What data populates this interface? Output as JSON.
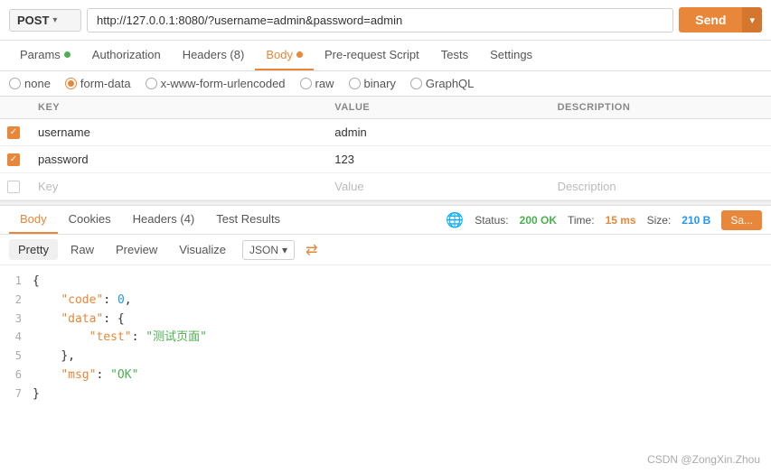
{
  "method": {
    "label": "POST",
    "chevron": "▾"
  },
  "url": {
    "value": "http://127.0.0.1:8080/?username=admin&password=admin"
  },
  "toolbar": {
    "send_label": "Send",
    "arrow_label": "▾"
  },
  "req_tabs": [
    {
      "label": "Params",
      "dot": "green",
      "active": false
    },
    {
      "label": "Authorization",
      "dot": null,
      "active": false
    },
    {
      "label": "Headers",
      "dot": null,
      "badge": "8",
      "active": false
    },
    {
      "label": "Body",
      "dot": "orange",
      "active": true
    },
    {
      "label": "Pre-request Script",
      "dot": null,
      "active": false
    },
    {
      "label": "Tests",
      "dot": null,
      "active": false
    },
    {
      "label": "Settings",
      "dot": null,
      "active": false
    }
  ],
  "body_types": [
    {
      "label": "none",
      "selected": false
    },
    {
      "label": "form-data",
      "selected": true
    },
    {
      "label": "x-www-form-urlencoded",
      "selected": false
    },
    {
      "label": "raw",
      "selected": false
    },
    {
      "label": "binary",
      "selected": false
    },
    {
      "label": "GraphQL",
      "selected": false
    }
  ],
  "table": {
    "headers": [
      "KEY",
      "VALUE",
      "DESCRIPTION"
    ],
    "rows": [
      {
        "checked": true,
        "key": "username",
        "value": "admin",
        "description": ""
      },
      {
        "checked": true,
        "key": "password",
        "value": "123",
        "description": ""
      }
    ],
    "placeholder": {
      "key": "Key",
      "value": "Value",
      "description": "Description"
    }
  },
  "resp_tabs": [
    {
      "label": "Body",
      "active": true
    },
    {
      "label": "Cookies",
      "active": false
    },
    {
      "label": "Headers",
      "badge": "4",
      "active": false
    },
    {
      "label": "Test Results",
      "active": false
    }
  ],
  "response_status": {
    "globe_label": "🌐",
    "status_label": "Status:",
    "status_value": "200 OK",
    "time_label": "Time:",
    "time_value": "15 ms",
    "size_label": "Size:",
    "size_value": "210 B",
    "save_label": "Sa..."
  },
  "view_tabs": [
    {
      "label": "Pretty",
      "active": true
    },
    {
      "label": "Raw",
      "active": false
    },
    {
      "label": "Preview",
      "active": false
    },
    {
      "label": "Visualize",
      "active": false
    }
  ],
  "format_select": {
    "label": "JSON",
    "chevron": "▾"
  },
  "json_lines": [
    {
      "num": 1,
      "content": "{"
    },
    {
      "num": 2,
      "content": "    \"code\": 0,"
    },
    {
      "num": 3,
      "content": "    \"data\": {"
    },
    {
      "num": 4,
      "content": "        \"test\": \"测试页面\""
    },
    {
      "num": 5,
      "content": "    },"
    },
    {
      "num": 6,
      "content": "    \"msg\": \"OK\""
    },
    {
      "num": 7,
      "content": "}"
    }
  ],
  "watermark": {
    "text": "CSDN @ZongXin.Zhou"
  }
}
